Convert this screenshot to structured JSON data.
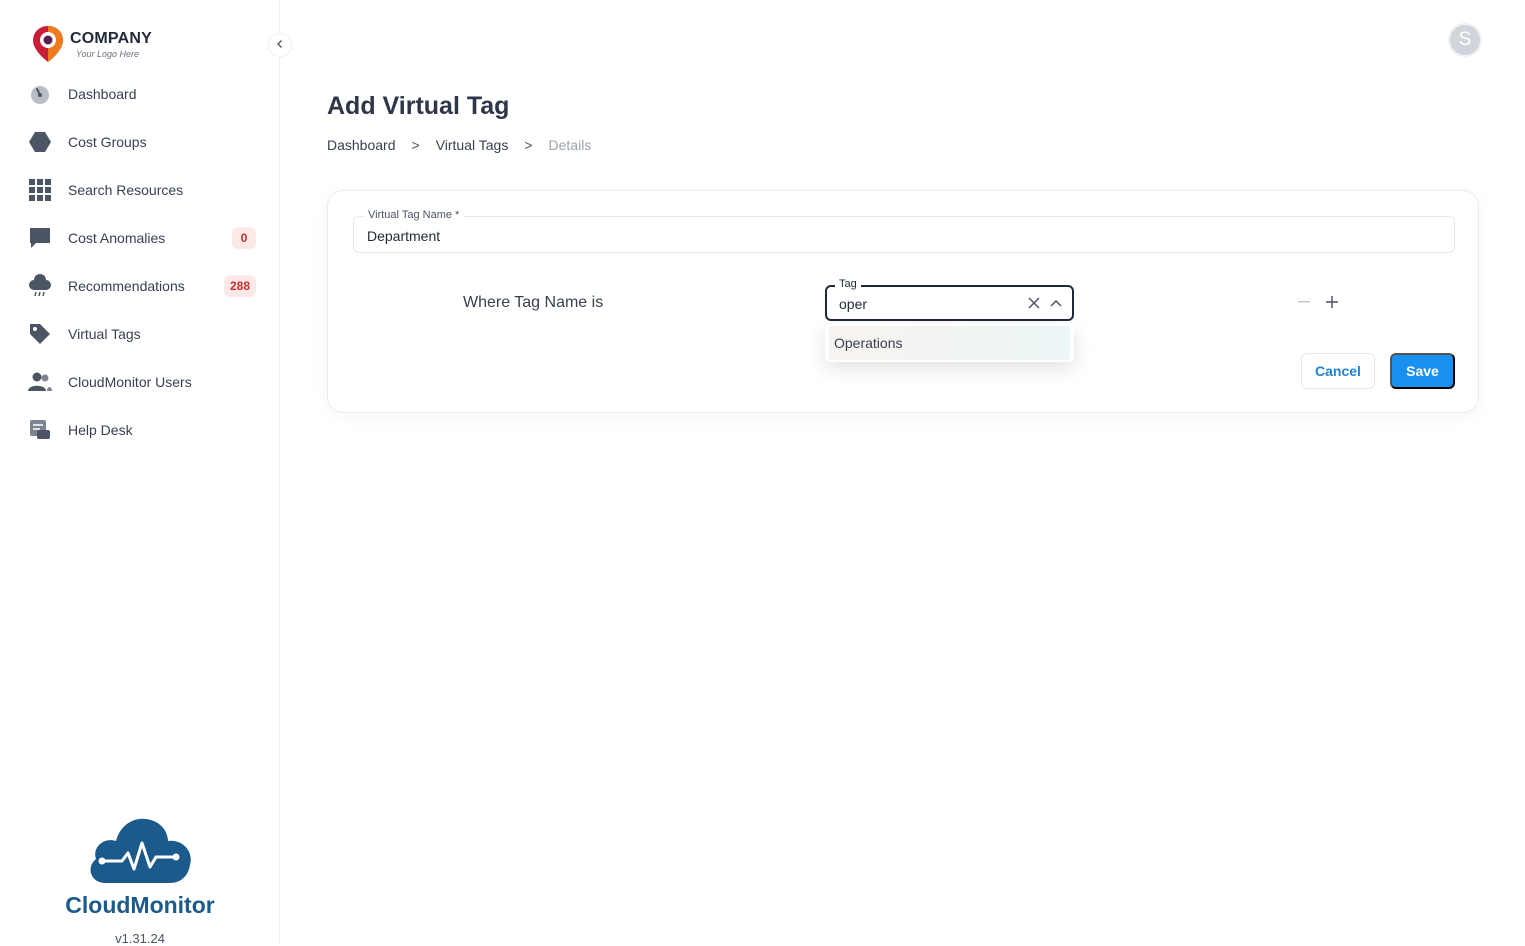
{
  "logo": {
    "name": "COMPANY",
    "tagline": "Your Logo Here"
  },
  "sidebar": {
    "collapse_icon": "chevron-left-icon",
    "items": [
      {
        "label": "Dashboard",
        "icon": "speedometer-icon"
      },
      {
        "label": "Cost Groups",
        "icon": "hexagon-icon"
      },
      {
        "label": "Search Resources",
        "icon": "grid-icon"
      },
      {
        "label": "Cost Anomalies",
        "icon": "chat-bubble-icon",
        "badge": "0"
      },
      {
        "label": "Recommendations",
        "icon": "cloud-rain-icon",
        "badge": "288"
      },
      {
        "label": "Virtual Tags",
        "icon": "tag-icon"
      },
      {
        "label": "CloudMonitor Users",
        "icon": "users-icon"
      },
      {
        "label": "Help Desk",
        "icon": "help-desk-icon"
      }
    ]
  },
  "brand": {
    "name": "CloudMonitor",
    "version": "v1.31.24"
  },
  "header": {
    "avatar_initial": "S"
  },
  "page": {
    "title": "Add Virtual Tag",
    "breadcrumb": [
      "Dashboard",
      "Virtual Tags",
      "Details"
    ],
    "breadcrumb_separator": ">"
  },
  "form": {
    "name_field": {
      "label": "Virtual Tag Name *",
      "value": "Department"
    },
    "rule": {
      "label": "Where Tag Name is",
      "tag_field": {
        "label": "Tag",
        "value": "oper"
      },
      "options": [
        "Operations"
      ]
    },
    "cancel_label": "Cancel",
    "save_label": "Save"
  },
  "colors": {
    "accent": "#1890f0",
    "brand": "#1c5a8c",
    "badge_bg": "#fde8e8",
    "badge_text": "#c53030"
  }
}
